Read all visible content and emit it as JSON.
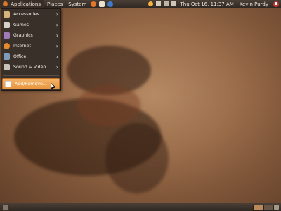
{
  "top_panel": {
    "menus": [
      "Applications",
      "Places",
      "System"
    ],
    "clock": "Thu Oct 16, 11:37 AM",
    "user": "Kevin Purdy"
  },
  "applications_menu": {
    "items": [
      {
        "label": "Accessories",
        "icon": "accessories-icon",
        "color": "#d8b27b"
      },
      {
        "label": "Games",
        "icon": "games-icon",
        "color": "#d8d3c8"
      },
      {
        "label": "Graphics",
        "icon": "graphics-icon",
        "color": "#9f7ab7"
      },
      {
        "label": "Internet",
        "icon": "internet-icon",
        "color": "#e58a2e"
      },
      {
        "label": "Office",
        "icon": "office-icon",
        "color": "#7f9bb8"
      },
      {
        "label": "Sound & Video",
        "icon": "sound-video-icon",
        "color": "#c9c2b8"
      }
    ],
    "selected": {
      "label": "Add/Remove...",
      "icon": "add-remove-icon"
    }
  },
  "colors": {
    "accent": "#e8953f",
    "panel": "#3a2f28"
  }
}
